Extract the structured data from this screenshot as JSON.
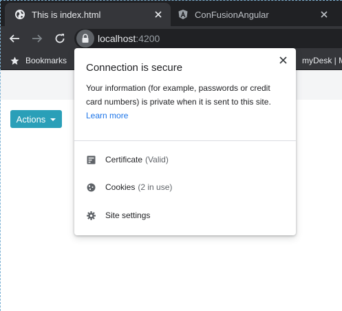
{
  "tabs": [
    {
      "title": "This is index.html",
      "active": true,
      "icon": "globe-icon"
    },
    {
      "title": "ConFusionAngular",
      "active": false,
      "icon": "angular-icon"
    }
  ],
  "toolbar": {
    "url_host": "localhost",
    "url_port": ":4200"
  },
  "bookmarks": {
    "bookmarks_label": "Bookmarks",
    "mydesk_label": "myDesk | M"
  },
  "page": {
    "actions_label": "Actions"
  },
  "site_info_popup": {
    "title": "Connection is secure",
    "description": "Your information (for example, passwords or credit card numbers) is private when it is sent to this site.",
    "learn_more": "Learn more",
    "rows": [
      {
        "label": "Certificate",
        "sub": "(Valid)",
        "icon": "certificate-icon"
      },
      {
        "label": "Cookies",
        "sub": "(2 in use)",
        "icon": "cookie-icon"
      },
      {
        "label": "Site settings",
        "sub": "",
        "icon": "gear-icon"
      }
    ]
  },
  "colors": {
    "tabstrip": "#202124",
    "toolbar": "#35363a",
    "accent_button": "#2a9fb8",
    "link": "#1a73e8"
  }
}
